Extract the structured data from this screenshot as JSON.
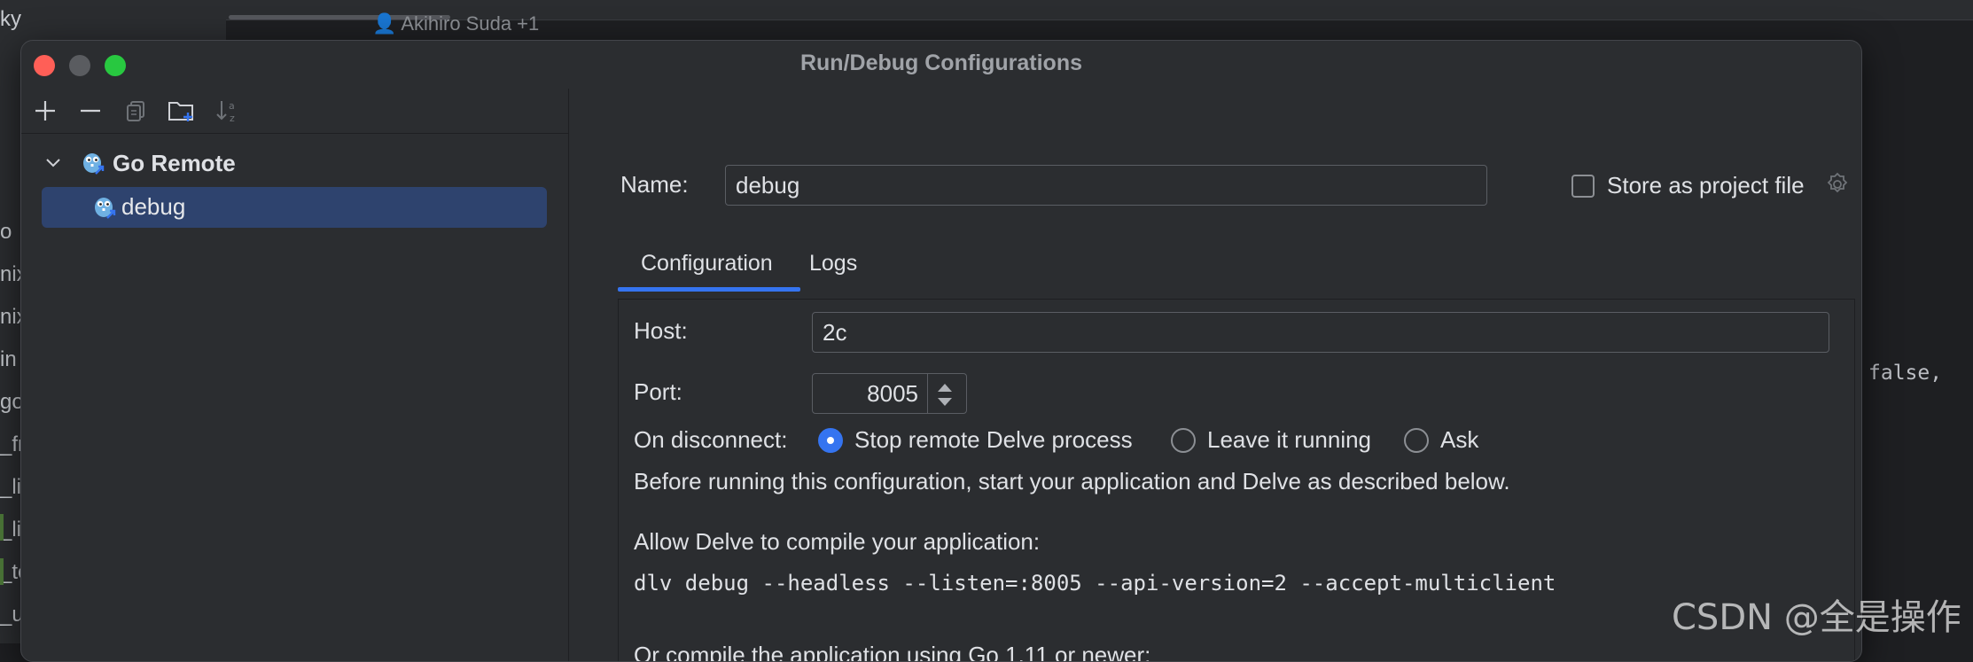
{
  "background": {
    "author": "Akihiro Suda +1",
    "sidebar_fragments": [
      "ky",
      "o",
      "nix",
      "nix",
      "in",
      "go",
      "_fr",
      "_lin",
      "_lin",
      "_te",
      "_ur"
    ],
    "code_fragment": "false,"
  },
  "dialog": {
    "title": "Run/Debug Configurations"
  },
  "tree": {
    "group_label": "Go Remote",
    "item_label": "debug"
  },
  "form": {
    "name_label": "Name:",
    "name_value": "debug",
    "store_label": "Store as project file",
    "store_checked": false
  },
  "tabs": [
    {
      "label": "Configuration",
      "active": true
    },
    {
      "label": "Logs",
      "active": false
    }
  ],
  "config": {
    "host_label": "Host:",
    "host_value": "2c",
    "port_label": "Port:",
    "port_value": "8005",
    "disconnect_label": "On disconnect:",
    "disconnect_options": [
      {
        "label": "Stop remote Delve process",
        "selected": true
      },
      {
        "label": "Leave it running",
        "selected": false
      },
      {
        "label": "Ask",
        "selected": false
      }
    ],
    "info_line": "Before running this configuration, start your application and Delve as described below.",
    "allow_label": "Allow Delve to compile your application:",
    "command": "dlv debug --headless --listen=:8005 --api-version=2 --accept-multiclient",
    "compile_label": "Or compile the application using Go 1.11 or newer:"
  },
  "watermark": "CSDN @全是操作",
  "colors": {
    "accent": "#3574f0",
    "selection": "#2e436e",
    "close": "#ff5f57",
    "maximize": "#28c840"
  }
}
